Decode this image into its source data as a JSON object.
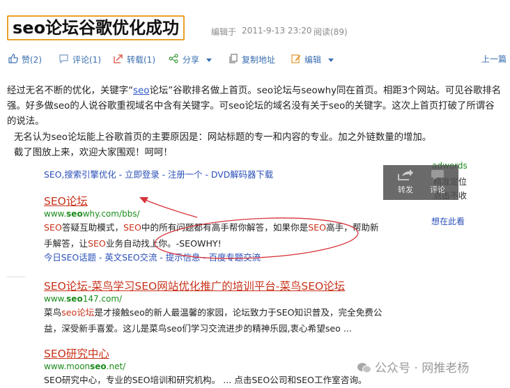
{
  "post": {
    "title": "seo论坛谷歌优化成功",
    "meta_edited": "编辑于",
    "meta_date": "2011-9-13 23:20",
    "meta_reads": "阅读(89)"
  },
  "toolbar": {
    "like": "赞(2)",
    "comment": "评论(1)",
    "repost": "转载(1)",
    "share": "分享",
    "copy_addr": "复制地址",
    "edit": "编辑",
    "prev": "上一篇"
  },
  "article": {
    "p1_a": "经过无名不断的优化，关键字“",
    "p1_link": "seo",
    "p1_b": "论坛”谷歌排名做上首页。seo论坛与seowhy同在首页。相距3个网站。可见谷歌排名",
    "p2": "强。好多做seo的人说谷歌重视域名中含有关键字。可seo论坛的域名没有关于seo的关键字。这次上首页打破了所谓谷",
    "p3": "的说法。",
    "p4": "无名认为seo论坛能上谷歌首页的主要原因是：网站标题的专一和内容的专业。加之外链数量的增加。",
    "p5": "截了图放上来，欢迎大家围观！呵呵！"
  },
  "screenshot": {
    "top_links": "SEO,搜索引擎优化 - 立即登录 - 注册一个 - DVD解码器下载",
    "results": [
      {
        "title": "SEO论坛",
        "url_a": "www.",
        "url_b": "seo",
        "url_c": "why.com/bbs/",
        "desc1_a": "SEO",
        "desc1_b": "答疑互助模式，",
        "desc1_c": "SEO",
        "desc1_d": "中的所有问题都有高手帮你解答，如果你是",
        "desc1_e": "SEO",
        "desc1_f": "高手，帮助新",
        "desc2_a": "手解答，让",
        "desc2_b": "SEO",
        "desc2_c": "业务自动找上你。-SEOWHY!",
        "sublinks": "今日SEO话题 - 英文SEO交流 - 提示信息 - 百度专题交流"
      },
      {
        "title": "SEO论坛-菜鸟学习SEO网站优化推广的培训平台-菜鸟SEO论坛",
        "url_a": "www.",
        "url_b": "seo",
        "url_c": "147.com/",
        "desc1_a": "菜鸟",
        "desc1_b": "seo论坛",
        "desc1_c": "是才接触seo的新人最温馨的家园，论坛致力于SEO知识普及，完全免费公",
        "desc2": "益，深受新手喜爱。这儿是菜鸟seo们学习交流进步的精神乐园,衷心希望seo ..."
      },
      {
        "title": "SEO研究中心",
        "url_a": "www.moon",
        "url_b": "seo",
        "url_c": ".net/",
        "desc1": "SEO研究中心，专业的SEO培训和研究机构。 ... 点击SEO公司和SEO工作室咨询。"
      }
    ],
    "side": {
      "adwords": "adwords",
      "line1": "精准定位",
      "line2": "点击不收",
      "ask": "想在此看"
    }
  },
  "overlay": {
    "repost": "转发",
    "comment": "评论"
  },
  "watermark": "公众号 · 网推老杨",
  "colors": {
    "link_blue": "#3a6fb0",
    "result_red": "#c8311a",
    "url_green": "#1a8a1a",
    "title_border": "#e8a028"
  }
}
